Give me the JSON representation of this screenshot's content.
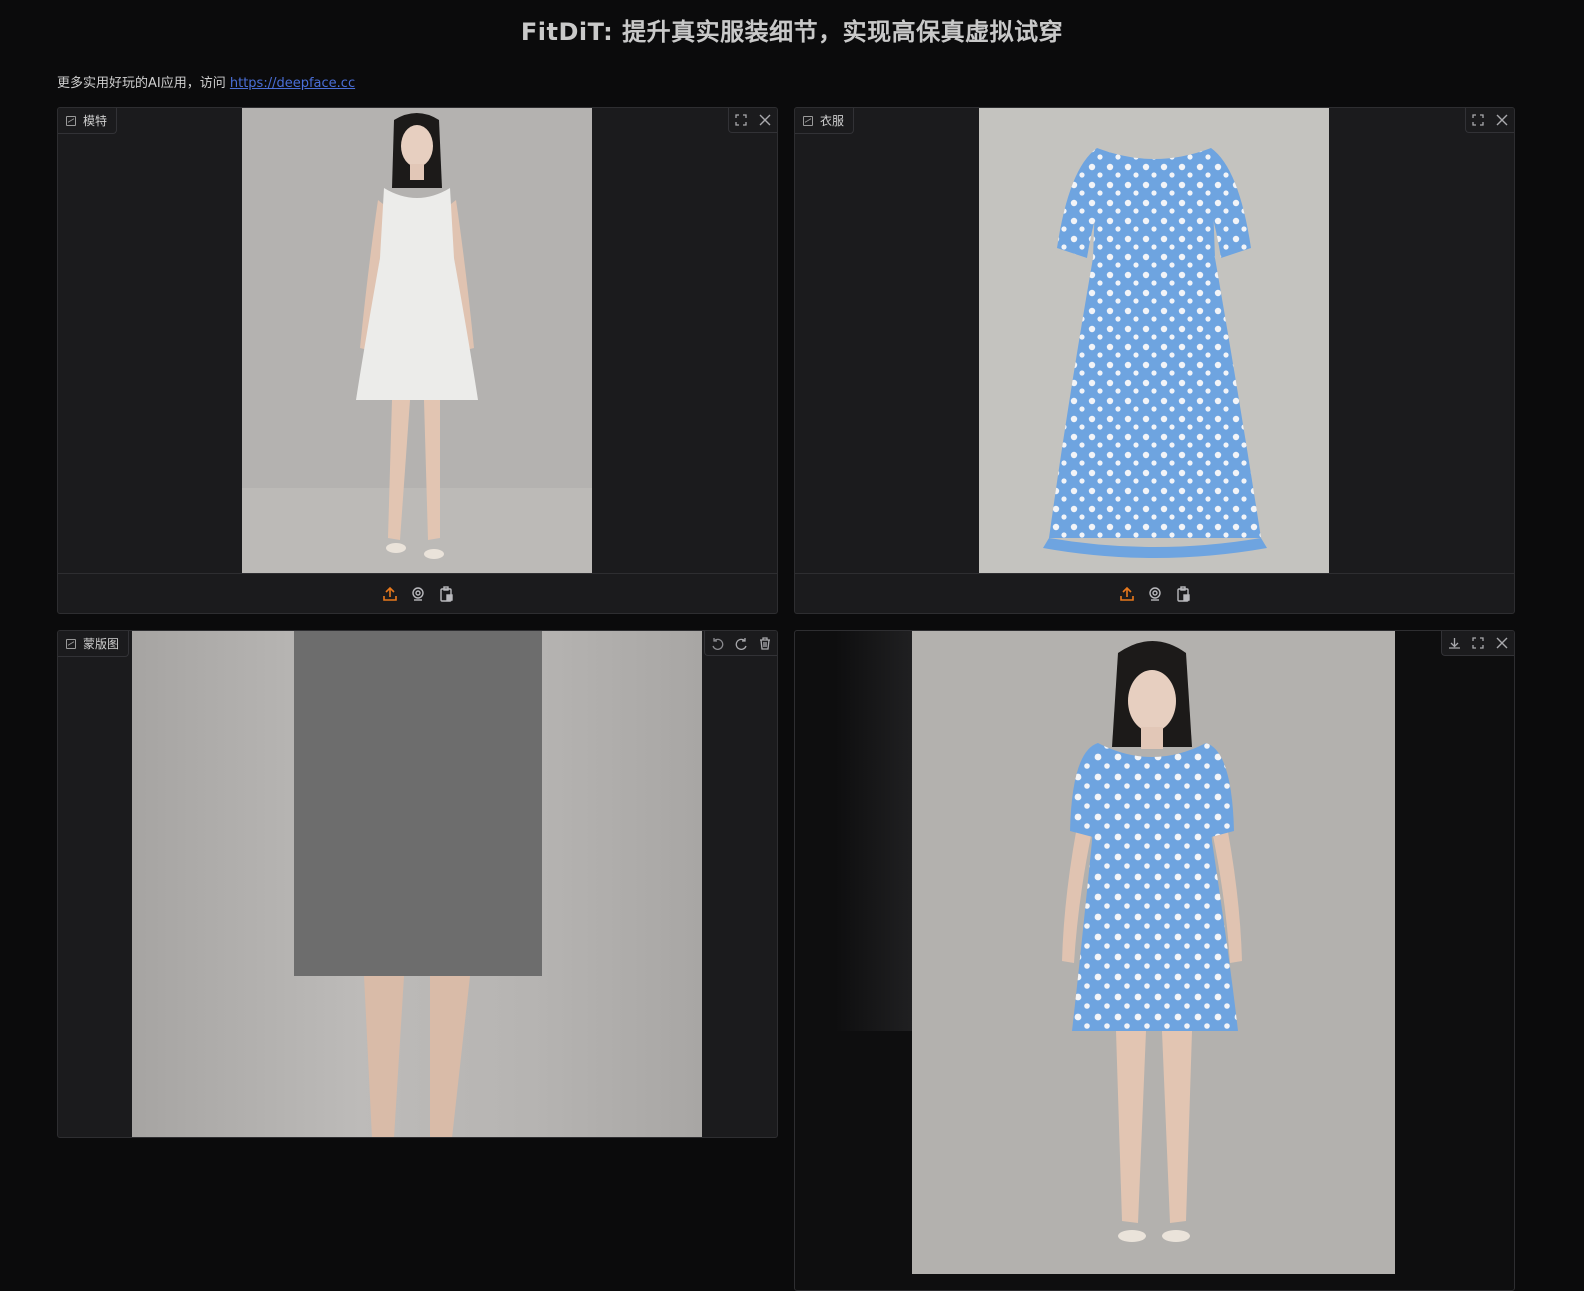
{
  "title": "FitDiT: 提升真实服装细节，实现高保真虚拟试穿",
  "subtitle": {
    "text": "更多实用好玩的AI应用，访问 ",
    "link": "https://deepface.cc"
  },
  "panels": {
    "model": {
      "label": "模特"
    },
    "garment": {
      "label": "衣服"
    },
    "mask": {
      "label": "蒙版图"
    }
  },
  "colors": {
    "background": "#0b0b0c",
    "panel": "#1b1b1d",
    "accent_upload": "#e8791d",
    "link": "#4a6fd8",
    "mask_gray": "#6d6d6d",
    "dress_blue": "#6ea4e0"
  },
  "icons": {
    "label": "image-icon",
    "fullscreen": "fullscreen-icon",
    "close": "close-icon",
    "upload": "upload-icon",
    "webcam": "webcam-icon",
    "clipboard": "clipboard-icon",
    "undo": "undo-icon",
    "redo": "redo-icon",
    "trash": "trash-icon",
    "download": "download-icon"
  }
}
